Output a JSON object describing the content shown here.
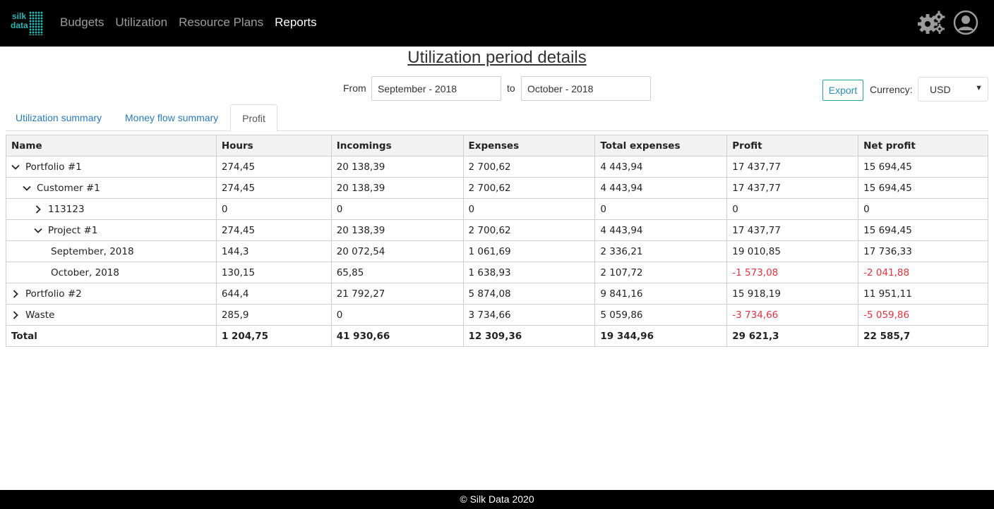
{
  "nav": {
    "logo_line1": "silk",
    "logo_line2": "data",
    "items": [
      {
        "label": "Budgets",
        "active": false
      },
      {
        "label": "Utilization",
        "active": false
      },
      {
        "label": "Resource Plans",
        "active": false
      },
      {
        "label": "Reports",
        "active": true
      }
    ],
    "settings_icon": "gears-icon",
    "user_icon": "user-circle-icon"
  },
  "page": {
    "title": "Utilization period details",
    "from_label": "From",
    "from_value": "September - 2018",
    "to_label": "to",
    "to_value": "October - 2018",
    "export_label": "Export",
    "currency_label": "Currency:",
    "currency_value": "USD"
  },
  "tabs": [
    {
      "label": "Utilization summary",
      "active": false
    },
    {
      "label": "Money flow summary",
      "active": false
    },
    {
      "label": "Profit",
      "active": true
    }
  ],
  "table": {
    "columns": [
      "Name",
      "Hours",
      "Incomings",
      "Expenses",
      "Total expenses",
      "Profit",
      "Net profit"
    ],
    "rows": [
      {
        "name": "Portfolio #1",
        "level": 0,
        "toggle": "expanded",
        "values": [
          "274,45",
          "20 138,39",
          "2 700,62",
          "4 443,94",
          "17 437,77",
          "15 694,45"
        ],
        "negative": [
          false,
          false,
          false,
          false,
          false,
          false
        ]
      },
      {
        "name": "Customer #1",
        "level": 1,
        "toggle": "expanded",
        "values": [
          "274,45",
          "20 138,39",
          "2 700,62",
          "4 443,94",
          "17 437,77",
          "15 694,45"
        ],
        "negative": [
          false,
          false,
          false,
          false,
          false,
          false
        ]
      },
      {
        "name": "113123",
        "level": 2,
        "toggle": "collapsed",
        "values": [
          "0",
          "0",
          "0",
          "0",
          "0",
          "0"
        ],
        "negative": [
          false,
          false,
          false,
          false,
          false,
          false
        ]
      },
      {
        "name": "Project #1",
        "level": 2,
        "toggle": "expanded",
        "values": [
          "274,45",
          "20 138,39",
          "2 700,62",
          "4 443,94",
          "17 437,77",
          "15 694,45"
        ],
        "negative": [
          false,
          false,
          false,
          false,
          false,
          false
        ]
      },
      {
        "name": "September, 2018",
        "level": 3,
        "toggle": "none",
        "values": [
          "144,3",
          "20 072,54",
          "1 061,69",
          "2 336,21",
          "19 010,85",
          "17 736,33"
        ],
        "negative": [
          false,
          false,
          false,
          false,
          false,
          false
        ]
      },
      {
        "name": "October, 2018",
        "level": 3,
        "toggle": "none",
        "values": [
          "130,15",
          "65,85",
          "1 638,93",
          "2 107,72",
          "-1 573,08",
          "-2 041,88"
        ],
        "negative": [
          false,
          false,
          false,
          false,
          true,
          true
        ]
      },
      {
        "name": "Portfolio #2",
        "level": 0,
        "toggle": "collapsed",
        "values": [
          "644,4",
          "21 792,27",
          "5 874,08",
          "9 841,16",
          "15 918,19",
          "11 951,11"
        ],
        "negative": [
          false,
          false,
          false,
          false,
          false,
          false
        ]
      },
      {
        "name": "Waste",
        "level": 0,
        "toggle": "collapsed",
        "values": [
          "285,9",
          "0",
          "3 734,66",
          "5 059,86",
          "-3 734,66",
          "-5 059,86"
        ],
        "negative": [
          false,
          false,
          false,
          false,
          true,
          true
        ]
      }
    ],
    "total": {
      "name": "Total",
      "values": [
        "1 204,75",
        "41 930,66",
        "12 309,36",
        "19 344,96",
        "29 621,3",
        "22 585,7"
      ]
    }
  },
  "colors": {
    "negative": "#e0343f",
    "link": "#2a7ab8",
    "brand": "#2fb5b1"
  },
  "footer": {
    "text": "© Silk Data 2020"
  }
}
